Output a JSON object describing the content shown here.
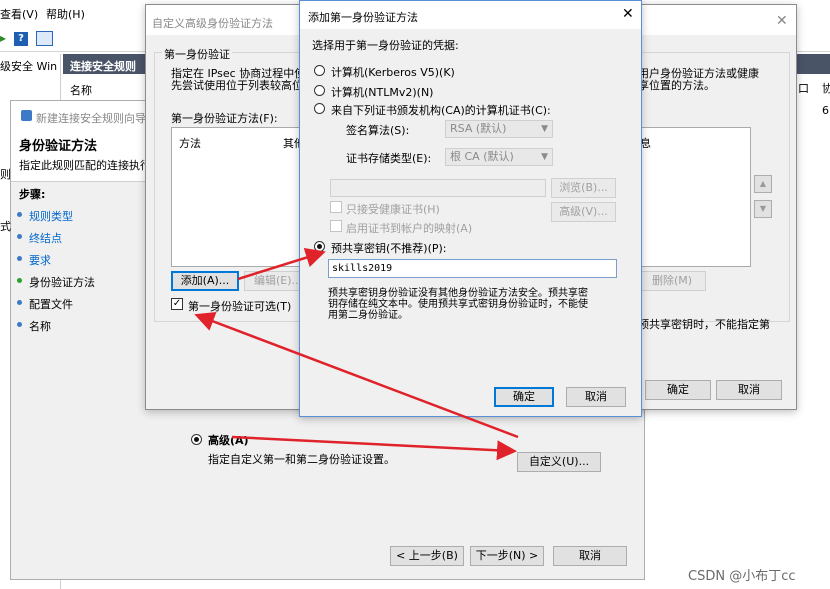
{
  "bg": {
    "menu_view": "查看(V)",
    "menu_help": "帮助(H)",
    "tree_item": "级安全 Win",
    "panel_header": "连接安全规则",
    "col_name": "名称",
    "right_text_1": "用户身份验证方法或健康",
    "right_text_2": "享位置的方法。",
    "right_col_1": "口",
    "right_col_2": "协",
    "right_col_3": "6"
  },
  "wizard": {
    "title": "新建连接安全规则向导",
    "heading": "身份验证方法",
    "desc": "指定此规则匹配的连接执行...",
    "steps_label": "步骤:",
    "steps": [
      {
        "label": "规则类型"
      },
      {
        "label": "终结点"
      },
      {
        "label": "要求"
      },
      {
        "label": "身份验证方法"
      },
      {
        "label": "配置文件"
      },
      {
        "label": "名称"
      }
    ],
    "left_edge_1": "则",
    "left_edge_2": "式",
    "advanced_label": "高级(A)",
    "advanced_desc": "指定自定义第一和第二身份验证设置。",
    "customize_button": "自定义(U)...",
    "back_button": "< 上一步(B)",
    "next_button": "下一步(N) >",
    "cancel_button": "取消"
  },
  "custom": {
    "title": "自定义高级身份验证方法",
    "group_title": "第一身份验证",
    "desc_1": "指定在 IPsec 协商过程中使",
    "desc_2": "先尝试使用位于列表较高位",
    "methods_label": "第一身份验证方法(F):",
    "col_method": "方法",
    "col_other": "其他",
    "add_button": "添加(A)...",
    "edit_button": "编辑(E)...",
    "delete_button": "删除(M)",
    "optional_label": "第一身份验证可选(T)",
    "col_right": "息",
    "right_warn": "预共享密钥时，不能指定第",
    "ok_button": "确定",
    "cancel_button": "取消"
  },
  "dialog": {
    "title": "添加第一身份验证方法",
    "prompt": "选择用于第一身份验证的凭据:",
    "opt_kerberos": "计算机(Kerberos V5)(K)",
    "opt_ntlm": "计算机(NTLMv2)(N)",
    "opt_ca": "来自下列证书颁发机构(CA)的计算机证书(C):",
    "sig_alg_label": "签名算法(S):",
    "sig_alg_value": "RSA (默认)",
    "cert_store_label": "证书存储类型(E):",
    "cert_store_value": "根 CA (默认)",
    "browse_button": "浏览(B)...",
    "advanced_button": "高级(V)...",
    "accept_health_label": "只接受健康证书(H)",
    "cert_mapping_label": "启用证书到帐户的映射(A)",
    "opt_psk": "预共享密钥(不推荐)(P):",
    "psk_value": "skills2019",
    "psk_note_1": "预共享密钥身份验证没有其他身份验证方法安全。预共享密",
    "psk_note_2": "钥存储在纯文本中。使用预共享式密钥身份验证时，不能使",
    "psk_note_3": "用第二身份验证。",
    "ok_button": "确定",
    "cancel_button": "取消",
    "selected": "psk"
  },
  "watermark": "CSDN @小布丁cc",
  "colors": {
    "accent": "#0078d7",
    "link": "#0066cc",
    "arrow": "#e0222a"
  }
}
